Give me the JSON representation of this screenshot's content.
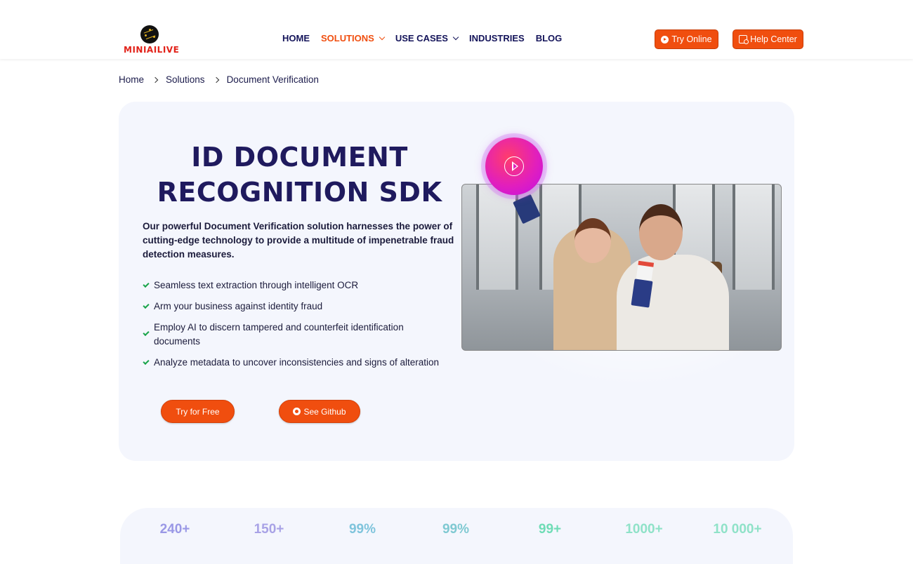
{
  "brand": {
    "name": "MINIAILIVE",
    "accent": "#f04e0f"
  },
  "nav": {
    "items": [
      {
        "label": "HOME",
        "dropdown": false,
        "active": false
      },
      {
        "label": "SOLUTIONS",
        "dropdown": true,
        "active": true
      },
      {
        "label": "USE CASES",
        "dropdown": true,
        "active": false
      },
      {
        "label": "INDUSTRIES",
        "dropdown": false,
        "active": false
      },
      {
        "label": "BLOG",
        "dropdown": false,
        "active": false
      }
    ],
    "try_online": "Try Online",
    "help_center": "Help Center"
  },
  "breadcrumb": [
    "Home",
    "Solutions",
    "Document Verification"
  ],
  "hero": {
    "title_line1": "ID DOCUMENT",
    "title_line2": "RECOGNITION SDK",
    "description": "Our powerful Document Verification solution harnesses the power of cutting-edge technology to provide a multitude of impenetrable fraud detection measures.",
    "features": [
      "Seamless text extraction through intelligent OCR",
      "Arm your business against identity fraud",
      "Employ AI to discern tampered and counterfeit identification documents",
      "Analyze metadata to uncover inconsistencies and signs of alteration"
    ],
    "try_free": "Try for Free",
    "see_github": "See Github"
  },
  "stats": [
    {
      "value": "240+",
      "color": "#9a98e6"
    },
    {
      "value": "150+",
      "color": "#a8a2e6"
    },
    {
      "value": "99%",
      "color": "#7fc4dc"
    },
    {
      "value": "99%",
      "color": "#7fc9d2"
    },
    {
      "value": "99+",
      "color": "#6fdcb6"
    },
    {
      "value": "1000+",
      "color": "#8fe2c8"
    },
    {
      "value": "10 000+",
      "color": "#8fe2c8"
    }
  ]
}
